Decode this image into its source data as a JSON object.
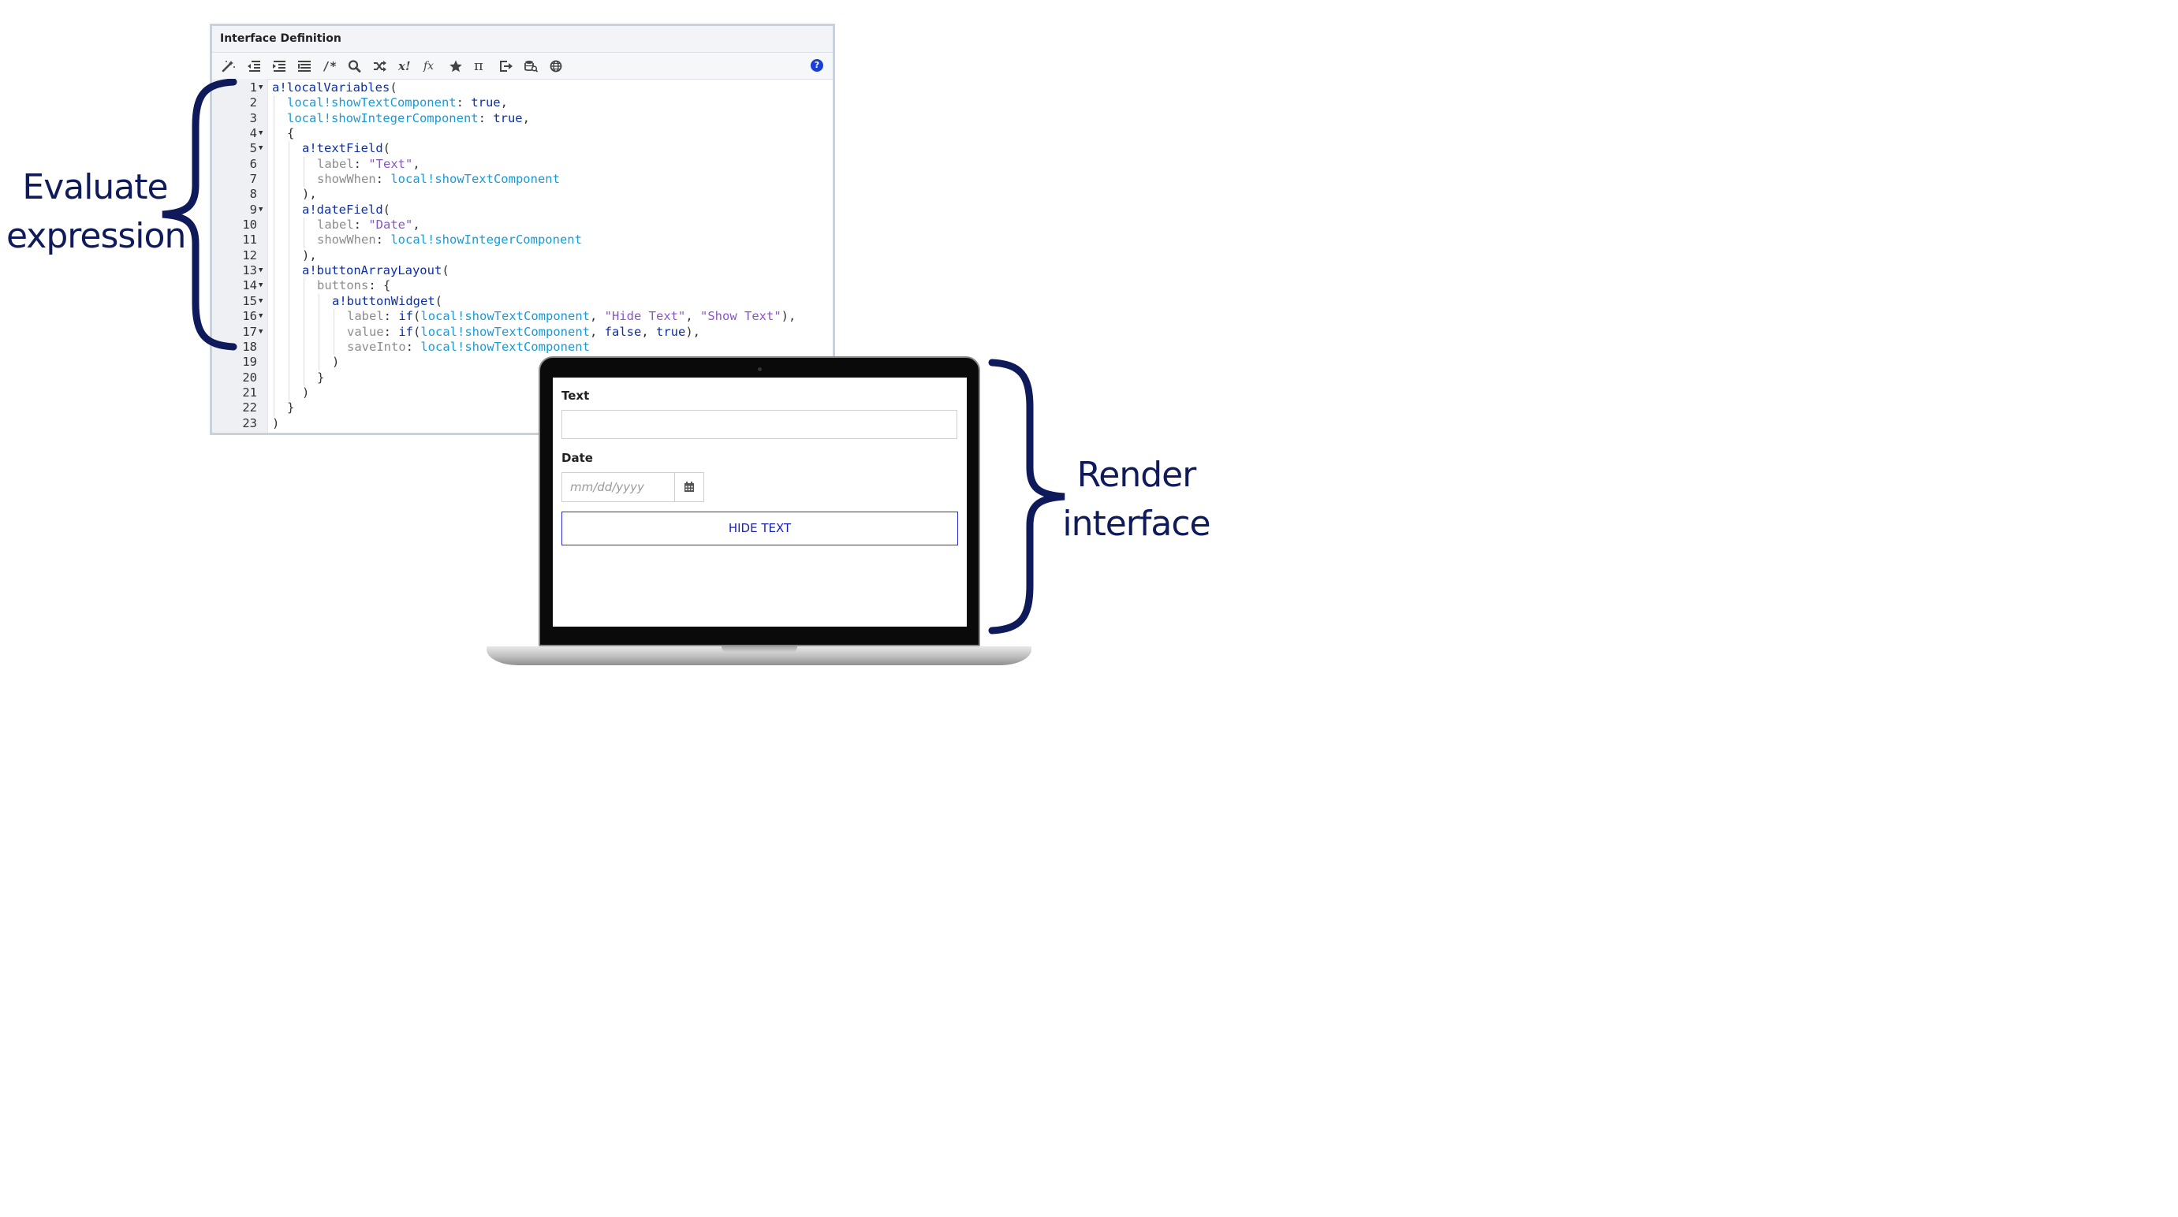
{
  "editor": {
    "title": "Interface Definition",
    "toolbar": [
      {
        "name": "format-wand-icon"
      },
      {
        "name": "outdent-icon"
      },
      {
        "name": "indent-icon"
      },
      {
        "name": "list-indent-icon"
      },
      {
        "name": "comment-icon",
        "glyph": "/*"
      },
      {
        "name": "search-icon"
      },
      {
        "name": "shuffle-icon"
      },
      {
        "name": "factorial-icon",
        "glyph": "x!"
      },
      {
        "name": "function-icon",
        "glyph": "fx"
      },
      {
        "name": "star-icon"
      },
      {
        "name": "pi-icon",
        "glyph": "π"
      },
      {
        "name": "export-icon"
      },
      {
        "name": "database-search-icon"
      },
      {
        "name": "globe-icon"
      }
    ],
    "help_glyph": "?",
    "lines": [
      {
        "n": "1",
        "fold": true,
        "guides": 0,
        "tokens": [
          [
            "kf",
            "a!localVariables"
          ],
          [
            "kx",
            "("
          ]
        ]
      },
      {
        "n": "2",
        "fold": false,
        "guides": 1,
        "tokens": [
          [
            "kl",
            "local!showTextComponent"
          ],
          [
            "kx",
            ": "
          ],
          [
            "kb",
            "true"
          ],
          [
            "kx",
            ","
          ]
        ]
      },
      {
        "n": "3",
        "fold": false,
        "guides": 1,
        "tokens": [
          [
            "kl",
            "local!showIntegerComponent"
          ],
          [
            "kx",
            ": "
          ],
          [
            "kb",
            "true"
          ],
          [
            "kx",
            ","
          ]
        ]
      },
      {
        "n": "4",
        "fold": true,
        "guides": 1,
        "tokens": [
          [
            "kx",
            "{"
          ]
        ]
      },
      {
        "n": "5",
        "fold": true,
        "guides": 2,
        "tokens": [
          [
            "kf",
            "a!textField"
          ],
          [
            "kx",
            "("
          ]
        ]
      },
      {
        "n": "6",
        "fold": false,
        "guides": 3,
        "tokens": [
          [
            "kp",
            "label"
          ],
          [
            "kx",
            ": "
          ],
          [
            "ks",
            "\"Text\""
          ],
          [
            "kx",
            ","
          ]
        ]
      },
      {
        "n": "7",
        "fold": false,
        "guides": 3,
        "tokens": [
          [
            "kp",
            "showWhen"
          ],
          [
            "kx",
            ": "
          ],
          [
            "kl",
            "local!showTextComponent"
          ]
        ]
      },
      {
        "n": "8",
        "fold": false,
        "guides": 2,
        "tokens": [
          [
            "kx",
            "),"
          ]
        ]
      },
      {
        "n": "9",
        "fold": true,
        "guides": 2,
        "tokens": [
          [
            "kf",
            "a!dateField"
          ],
          [
            "kx",
            "("
          ]
        ]
      },
      {
        "n": "10",
        "fold": false,
        "guides": 3,
        "tokens": [
          [
            "kp",
            "label"
          ],
          [
            "kx",
            ": "
          ],
          [
            "ks",
            "\"Date\""
          ],
          [
            "kx",
            ","
          ]
        ]
      },
      {
        "n": "11",
        "fold": false,
        "guides": 3,
        "tokens": [
          [
            "kp",
            "showWhen"
          ],
          [
            "kx",
            ": "
          ],
          [
            "kl",
            "local!showIntegerComponent"
          ]
        ]
      },
      {
        "n": "12",
        "fold": false,
        "guides": 2,
        "tokens": [
          [
            "kx",
            "),"
          ]
        ]
      },
      {
        "n": "13",
        "fold": true,
        "guides": 2,
        "tokens": [
          [
            "kf",
            "a!buttonArrayLayout"
          ],
          [
            "kx",
            "("
          ]
        ]
      },
      {
        "n": "14",
        "fold": true,
        "guides": 3,
        "tokens": [
          [
            "kp",
            "buttons"
          ],
          [
            "kx",
            ": {"
          ]
        ]
      },
      {
        "n": "15",
        "fold": true,
        "guides": 4,
        "tokens": [
          [
            "kf",
            "a!buttonWidget"
          ],
          [
            "kx",
            "("
          ]
        ]
      },
      {
        "n": "16",
        "fold": true,
        "guides": 5,
        "tokens": [
          [
            "kp",
            "label"
          ],
          [
            "kx",
            ": "
          ],
          [
            "kf",
            "if"
          ],
          [
            "kx",
            "("
          ],
          [
            "kl",
            "local!showTextComponent"
          ],
          [
            "kx",
            ", "
          ],
          [
            "ks",
            "\"Hide Text\""
          ],
          [
            "kx",
            ", "
          ],
          [
            "ks",
            "\"Show Text\""
          ],
          [
            "kx",
            "),"
          ]
        ]
      },
      {
        "n": "17",
        "fold": true,
        "guides": 5,
        "tokens": [
          [
            "kp",
            "value"
          ],
          [
            "kx",
            ": "
          ],
          [
            "kf",
            "if"
          ],
          [
            "kx",
            "("
          ],
          [
            "kl",
            "local!showTextComponent"
          ],
          [
            "kx",
            ", "
          ],
          [
            "kb",
            "false"
          ],
          [
            "kx",
            ", "
          ],
          [
            "kb",
            "true"
          ],
          [
            "kx",
            "),"
          ]
        ]
      },
      {
        "n": "18",
        "fold": false,
        "guides": 5,
        "tokens": [
          [
            "kp",
            "saveInto"
          ],
          [
            "kx",
            ": "
          ],
          [
            "kl",
            "local!showTextComponent"
          ]
        ]
      },
      {
        "n": "19",
        "fold": false,
        "guides": 4,
        "tokens": [
          [
            "kx",
            ")"
          ]
        ]
      },
      {
        "n": "20",
        "fold": false,
        "guides": 3,
        "tokens": [
          [
            "kx",
            "}"
          ]
        ]
      },
      {
        "n": "21",
        "fold": false,
        "guides": 2,
        "tokens": [
          [
            "kx",
            ")"
          ]
        ]
      },
      {
        "n": "22",
        "fold": false,
        "guides": 1,
        "tokens": [
          [
            "kx",
            "}"
          ]
        ]
      },
      {
        "n": "23",
        "fold": false,
        "guides": 0,
        "tokens": [
          [
            "kx",
            ")"
          ]
        ]
      }
    ]
  },
  "annotations": {
    "left_line1": "Evaluate",
    "left_line2": "expression",
    "right_line1": "Render",
    "right_line2": "interface"
  },
  "rendered": {
    "text_label": "Text",
    "text_value": "",
    "date_label": "Date",
    "date_placeholder": "mm/dd/yyyy",
    "button_label": "HIDE TEXT"
  },
  "colors": {
    "annotation": "#0f1a5a",
    "function": "#0b2fa8",
    "local": "#1a9ad6",
    "string": "#8a55c9",
    "param": "#8c8c8c",
    "button_border": "#2a2fcf"
  }
}
